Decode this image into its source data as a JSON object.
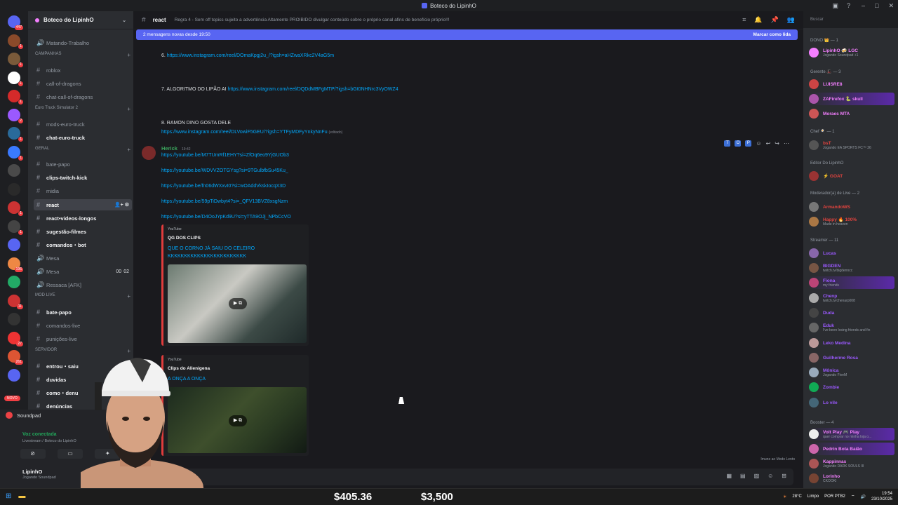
{
  "window": {
    "title": "Boteco do LipinhO"
  },
  "guild": {
    "name": "Boteco do LipinhO"
  },
  "servers": [
    {
      "badge": "447"
    },
    {
      "badge": "1"
    },
    {
      "badge": "1"
    },
    {
      "badge": "1"
    },
    {
      "badge": "1"
    },
    {
      "badge": "2"
    },
    {
      "badge": "1"
    },
    {
      "badge": "1"
    },
    {
      "badge": ""
    },
    {
      "badge": ""
    },
    {
      "badge": "1"
    },
    {
      "badge": "1"
    },
    {
      "badge": ""
    },
    {
      "badge": "196"
    },
    {
      "badge": ""
    },
    {
      "badge": "11"
    },
    {
      "badge": ""
    },
    {
      "badge": "27"
    },
    {
      "badge": "261"
    },
    {
      "badge": ""
    }
  ],
  "channels": {
    "items": [
      {
        "name": "Matando-Trabalho"
      },
      {
        "name": "roblox"
      },
      {
        "name": "call-of-dragons"
      },
      {
        "name": "chat-call-of-dragons"
      },
      {
        "name": "mods-euro-truck"
      },
      {
        "name": "chat-euro-truck"
      },
      {
        "name": "bate-papo"
      },
      {
        "name": "clips-twitch-kick"
      },
      {
        "name": "midia"
      },
      {
        "name": "react"
      },
      {
        "name": "react•videos-longos"
      },
      {
        "name": "sugestão-filmes"
      },
      {
        "name": "comandos・bot"
      },
      {
        "name": "Mesa"
      },
      {
        "name": "Mesa"
      },
      {
        "name": "Ressaca [AFK]"
      },
      {
        "name": "bate-papo"
      },
      {
        "name": "comandos-live"
      },
      {
        "name": "punições-live"
      },
      {
        "name": "entrou・saiu"
      },
      {
        "name": "duvidas"
      },
      {
        "name": "como・denu"
      },
      {
        "name": "denúncias"
      }
    ],
    "categories": [
      "CAMPANHAS",
      "Euro Truck Simulator 2",
      "GERAL",
      "MOD LIVE",
      "SERVIDOR"
    ],
    "voice_counts": [
      "00",
      "02"
    ]
  },
  "soundpad": "Soundpad",
  "voice": {
    "status": "Voz conectada",
    "sub": "Livestream / Boteco do LipinhO"
  },
  "user": {
    "name": "LipinhO",
    "status": "Jogando Soundpad"
  },
  "novo": "NOVO",
  "chat": {
    "channel": "react",
    "topic": "Regra 4 - Sem off topics sujeito a advertência Altamente PROIBIDO divulgar conteúdo sobre o próprio canal afins de benefício próprio!!!",
    "new_messages": "2 mensagens novas desde 19:50",
    "mark_read": "Marcar como lida",
    "lines": [
      {
        "prefix": "6. ",
        "link": "https://www.instagram.com/reel/DOmaKpgj2u_/?igsh=aHZwaXRkc2V4aG5m"
      },
      {
        "prefix": "7. ALGORITMO DO LIPÃO AI ",
        "link": "https://www.instagram.com/reel/DQDdMBFgMTP/?igsh=bGt0NHNrc3VyOWZ4"
      },
      {
        "prefix": "8. RAMON DINO GOSTA DELE",
        "link": ""
      },
      {
        "prefix": "",
        "link": "https://www.instagram.com/reel/DLVowiF5GEU/?igsh=YTFyMDFyYnkyNnFu",
        "edited": "(editado)"
      }
    ],
    "author": {
      "name": "Herick",
      "time": "19:42"
    },
    "links": [
      "https://youtube.be/M7TUmRf1EHY?si=ZfOq6eo9YjGUOb3",
      "https://youtube.be/WDVVZOTGYsg?si=9TGulbfbSu45Ku_",
      "https://youtube.be/fn06dWXxvI0?si=wOAddVkskIocqX3D",
      "https://youtube.be/59pTiDwbyt4?si=_QFV13BVZ8xsgNzm",
      "https://youtube.be/D4OoJYpKd9U?si=yTTA9OJj_NPbCcVO"
    ],
    "embeds": [
      {
        "provider": "YouTube",
        "channel": "QG DOS CLIPS",
        "title": "QUE O CORNO JÁ SAIU DO CELEIRO KKKKKKKKKKKKKKKKKKKKKKKK"
      },
      {
        "provider": "YouTube",
        "channel": "Clips do Alienigena",
        "title": "A ONÇA A ONÇA"
      }
    ],
    "slowmode": "Imune ao Modo Lento"
  },
  "search": {
    "placeholder": "Buscar"
  },
  "members": {
    "groups": [
      {
        "label": "DONO 👑 — 1"
      },
      {
        "label": "Gerente 🎩 — 3"
      },
      {
        "label": "Chef 🍳 — 1"
      },
      {
        "label": "Editor Do LipinhO"
      },
      {
        "label": "Moderador(a) de Live — 2"
      },
      {
        "label": "Streamer — 11"
      },
      {
        "label": "Booster — 4"
      }
    ],
    "list": [
      {
        "name": "LipinhO 🍻 LGC",
        "status": "Jogando Soundpad +1",
        "color": "#f47fff"
      },
      {
        "name": "LUISRE8",
        "status": "",
        "color": "#f47fff"
      },
      {
        "name": "ZAFirefox 🐍 skull",
        "status": "",
        "color": "#f47fff"
      },
      {
        "name": "Moraes MTA",
        "status": "",
        "color": "#f47fff"
      },
      {
        "name": "bsT",
        "status": "Jogando EA SPORTS FC™ 26",
        "color": "#e0433e"
      },
      {
        "name": "⚡ GOAT",
        "status": "",
        "color": "#e0433e"
      },
      {
        "name": "ArmandoWS",
        "status": "",
        "color": "#e0433e"
      },
      {
        "name": "Happy 🔥 100%",
        "status": "Made in heaven",
        "color": "#e0433e"
      },
      {
        "name": "Lucas",
        "status": "",
        "color": "#9b59ff"
      },
      {
        "name": "BIGDEN",
        "status": "twitch.tv/bigdenncc",
        "color": "#9b59ff"
      },
      {
        "name": "Fiona",
        "status": "my friends",
        "color": "#9b59ff"
      },
      {
        "name": "Chenp",
        "status": "twitch.tv/chenarp008",
        "color": "#9b59ff"
      },
      {
        "name": "Duda",
        "status": "",
        "color": "#9b59ff"
      },
      {
        "name": "Eduk",
        "status": "I've been losing friends and fin",
        "color": "#9b59ff"
      },
      {
        "name": "Leko Medina",
        "status": "",
        "color": "#9b59ff"
      },
      {
        "name": "Guilherme Rosa",
        "status": "",
        "color": "#9b59ff"
      },
      {
        "name": "Mônica",
        "status": "Jogando FiveM",
        "color": "#9b59ff"
      },
      {
        "name": "Zombie",
        "status": "",
        "color": "#9b59ff"
      },
      {
        "name": "Lo vile",
        "status": "",
        "color": "#9b59ff"
      },
      {
        "name": "Volt Play 🎮 Play",
        "status": "quer comprar no minha loja o...",
        "color": "#f47fff"
      },
      {
        "name": "Pedrin Bota Baião",
        "status": "",
        "color": "#f47fff"
      },
      {
        "name": "Kappinnas",
        "status": "Jogando DARK SOULS III",
        "color": "#f47fff"
      },
      {
        "name": "Lorinho",
        "status": "CKOOKI",
        "color": "#f47fff"
      }
    ]
  },
  "taskbar": {
    "money_1": "$405.36",
    "money_2": "$3,500",
    "weather": "28°C",
    "weather_desc": "Limpo",
    "lang": "POR",
    "layout": "PTB2",
    "time": "19:54",
    "date": "23/10/2025"
  }
}
